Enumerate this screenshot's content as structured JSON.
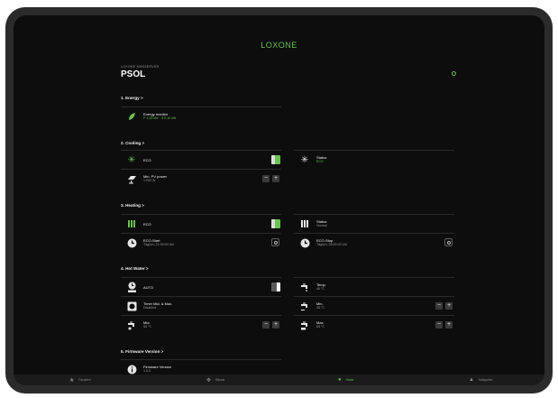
{
  "brand": "LOXONE",
  "header": {
    "subtitle": "LOXONE MINISERVER",
    "title": "PSOL"
  },
  "sections": [
    {
      "title": "1. Energy >"
    },
    {
      "title": "2. Cooling >"
    },
    {
      "title": "3. Heating >"
    },
    {
      "title": "4. Hot Water >"
    },
    {
      "title": "5. Firmware Version >"
    }
  ],
  "energy": {
    "label": "Energy monitor",
    "value": "P 1,29 kW · Ǝ 0,10 kW"
  },
  "cooling": {
    "eco": {
      "label": "ECO"
    },
    "status": {
      "label": "Status",
      "value": "ECO"
    },
    "min_pv": {
      "label": "Min. PV power",
      "value": "1.000 W"
    }
  },
  "heating": {
    "eco": {
      "label": "ECO"
    },
    "status": {
      "label": "Status",
      "value": "Normal"
    },
    "eco_start": {
      "label": "ECO-Start",
      "value": "Täglich, 21:00:00 Uhr"
    },
    "eco_stop": {
      "label": "ECO-Stop",
      "value": "Täglich, 05:00:00 Uhr"
    }
  },
  "hot_water": {
    "auto": {
      "label": "AUTO"
    },
    "temp": {
      "label": "Temp.",
      "value": "45 °C"
    },
    "timer": {
      "label": "Timer Mid. & Max.",
      "value": "Disabled"
    },
    "min": {
      "label": "Min.",
      "value": "45 °C"
    },
    "mid": {
      "label": "Mid.",
      "value": "55 °C"
    },
    "max": {
      "label": "Max.",
      "value": "65 °C"
    }
  },
  "firmware": {
    "label": "Firmware Version",
    "value": "1.0.0"
  },
  "stepper": {
    "minus": "−",
    "plus": "+"
  },
  "tabs": [
    {
      "label": "Favoriten",
      "icon": "star-icon"
    },
    {
      "label": "Räume",
      "icon": "move-icon"
    },
    {
      "label": "Home",
      "icon": "location-pin-icon",
      "active": true
    },
    {
      "label": "Kategorien",
      "icon": "categories-icon"
    }
  ],
  "colors": {
    "accent": "#69c350",
    "background": "#0d0d0d",
    "frame": "#2b2b2b"
  }
}
